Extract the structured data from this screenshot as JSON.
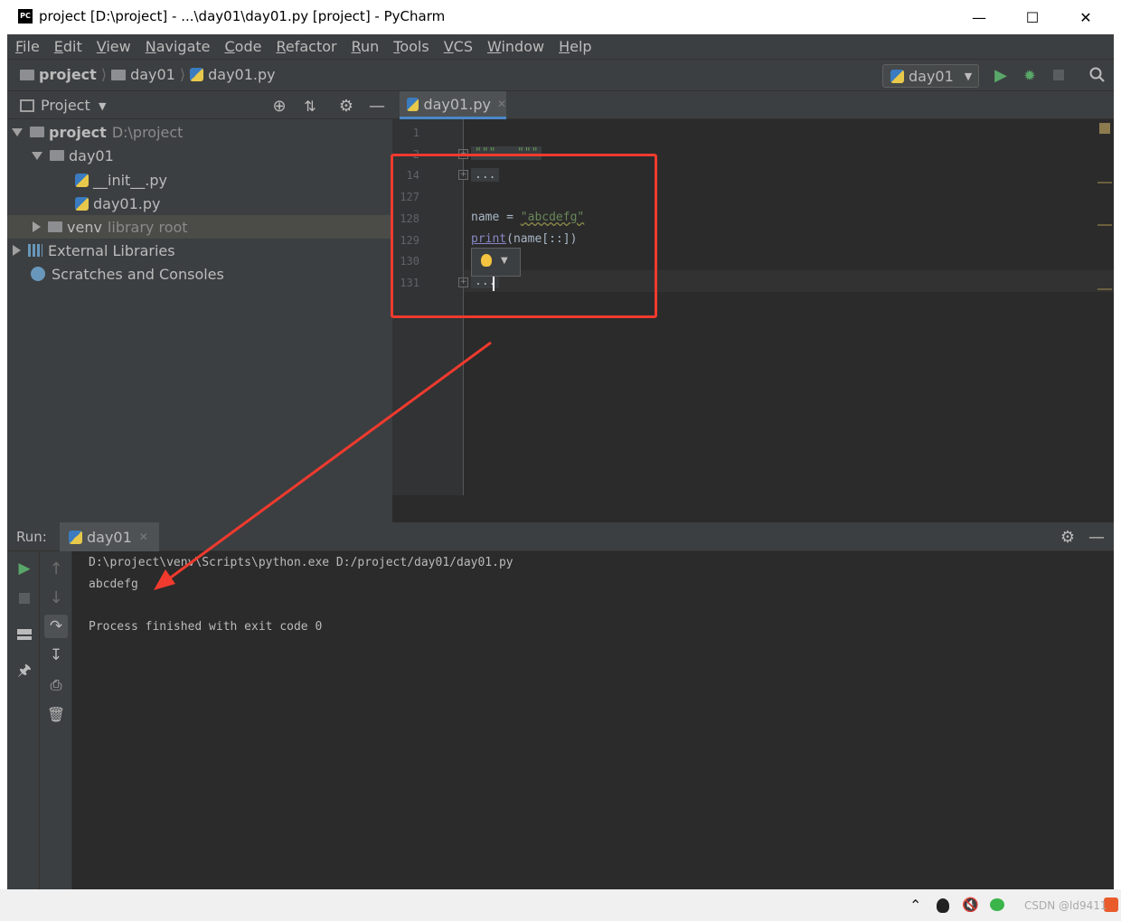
{
  "window": {
    "title": "project [D:\\project] - ...\\day01\\day01.py [project] - PyCharm",
    "app_icon_text": "PC",
    "minimize": "—",
    "maximize": "☐",
    "close": "✕"
  },
  "menu": [
    "File",
    "Edit",
    "View",
    "Navigate",
    "Code",
    "Refactor",
    "Run",
    "Tools",
    "VCS",
    "Window",
    "Help"
  ],
  "breadcrumb": {
    "project": "project",
    "folder": "day01",
    "file": "day01.py"
  },
  "run_config": {
    "label": "day01"
  },
  "project_panel": {
    "title": "Project",
    "tree": {
      "root_name": "project",
      "root_path": "D:\\project",
      "folder": "day01",
      "file1": "__init__.py",
      "file2": "day01.py",
      "venv": "venv",
      "venv_note": "library root",
      "external": "External Libraries",
      "scratches": "Scratches and Consoles"
    }
  },
  "editor": {
    "tab": "day01.py",
    "line_numbers": [
      "1",
      "2",
      "14",
      "127",
      "128",
      "129",
      "130",
      "131"
    ],
    "line2": "\"\"\"...\"\"\"",
    "line14": "...",
    "line128_a": "name = ",
    "line128_b": "\"abcdefg\"",
    "line129_a": "print",
    "line129_b": "(name[::])",
    "line131": "..."
  },
  "run_panel": {
    "label": "Run:",
    "tab": "day01",
    "output": [
      "D:\\project\\venv\\Scripts\\python.exe D:/project/day01/day01.py",
      "abcdefg",
      "",
      "Process finished with exit code 0"
    ]
  },
  "watermark": "CSDN @ld9411",
  "colors": {
    "annotation": "#f03a2e",
    "run_green": "#59a869",
    "editor_bg": "#2b2b2b",
    "panel_bg": "#3c3f41"
  }
}
